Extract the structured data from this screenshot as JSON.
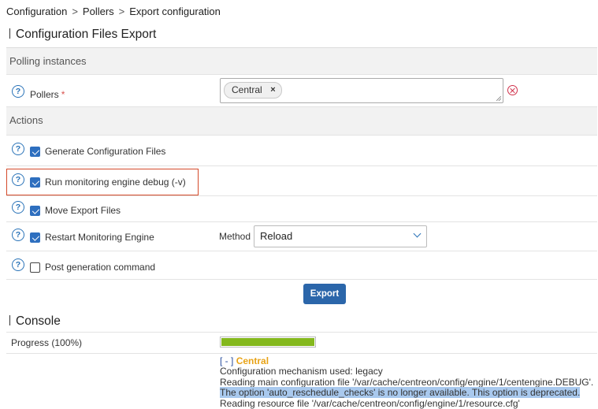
{
  "breadcrumb": {
    "items": [
      "Configuration",
      "Pollers",
      "Export configuration"
    ],
    "separator": ">"
  },
  "export_section": {
    "title": "Configuration Files Export"
  },
  "polling": {
    "header": "Polling instances",
    "pollers_label": "Pollers",
    "required_mark": "*",
    "selected": [
      "Central"
    ],
    "remove_glyph": "×"
  },
  "actions": {
    "header": "Actions",
    "help_glyph": "?",
    "items": [
      {
        "label": "Generate Configuration Files",
        "checked": true
      },
      {
        "label": "Run monitoring engine debug (-v)",
        "checked": true,
        "highlighted": true
      },
      {
        "label": "Move Export Files",
        "checked": true
      },
      {
        "label": "Restart Monitoring Engine",
        "checked": true
      },
      {
        "label": "Post generation command",
        "checked": false
      }
    ],
    "method_label": "Method",
    "method_value": "Reload"
  },
  "export_button": "Export",
  "console": {
    "title": "Console",
    "progress_label": "Progress (100%)",
    "progress_percent": 100,
    "toggle": "[ - ]",
    "poller_name": "Central",
    "lines": [
      "Configuration mechanism used: legacy",
      "Reading main configuration file '/var/cache/centreon/config/engine/1/centengine.DEBUG'.",
      "The option 'auto_reschedule_checks' is no longer available. This option is deprecated.",
      "Reading resource file '/var/cache/centreon/config/engine/1/resource.cfg'"
    ]
  },
  "colors": {
    "accent": "#2b66aa",
    "highlight_frame": "#d44a2a",
    "progress_fill": "#84b81d",
    "poller_name": "#e8a317",
    "clear_icon": "#d0304a"
  }
}
